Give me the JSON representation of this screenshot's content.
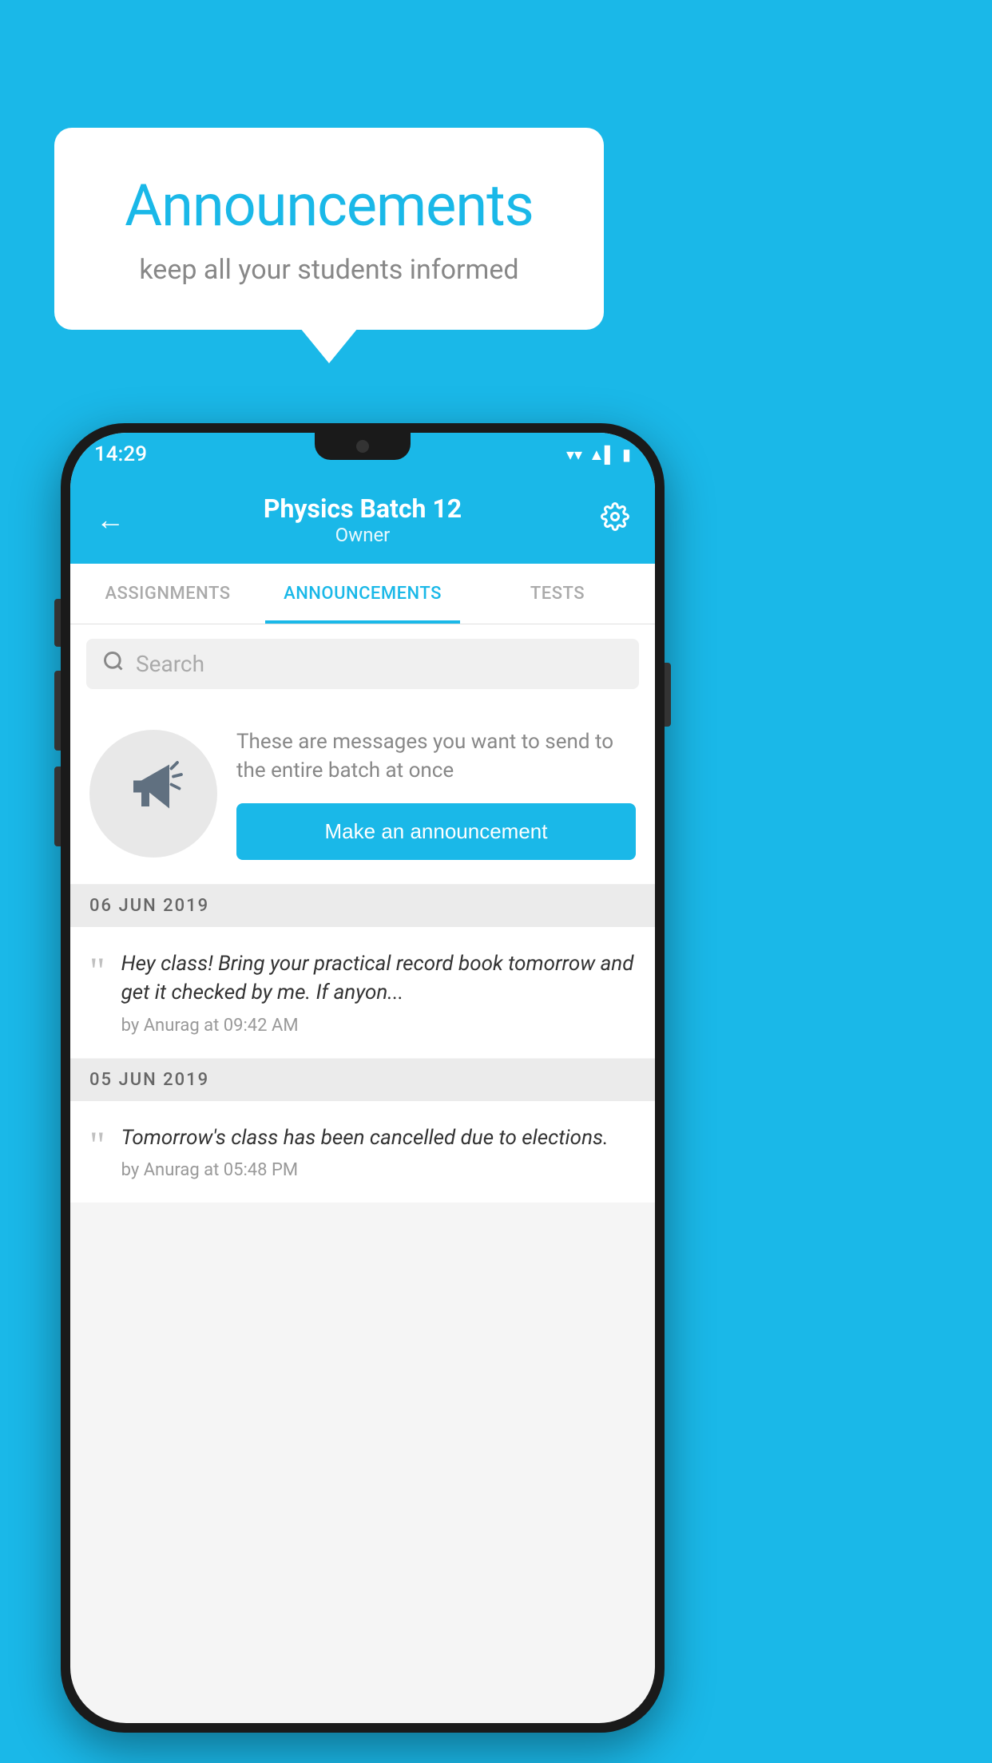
{
  "background": {
    "color": "#1ab8e8"
  },
  "speech_bubble": {
    "title": "Announcements",
    "subtitle": "keep all your students informed"
  },
  "phone": {
    "status_bar": {
      "time": "14:29",
      "wifi": "▼",
      "signal": "▲",
      "battery": "▮"
    },
    "app_bar": {
      "back_label": "←",
      "title": "Physics Batch 12",
      "subtitle": "Owner",
      "settings_label": "⚙"
    },
    "tabs": [
      {
        "label": "ASSIGNMENTS",
        "active": false
      },
      {
        "label": "ANNOUNCEMENTS",
        "active": true
      },
      {
        "label": "TESTS",
        "active": false
      }
    ],
    "search": {
      "placeholder": "Search"
    },
    "announcement_prompt": {
      "description": "These are messages you want to send to the entire batch at once",
      "button_label": "Make an announcement"
    },
    "announcements": [
      {
        "date": "06  JUN  2019",
        "message": "Hey class! Bring your practical record book tomorrow and get it checked by me. If anyon...",
        "meta": "by Anurag at 09:42 AM"
      },
      {
        "date": "05  JUN  2019",
        "message": "Tomorrow's class has been cancelled due to elections.",
        "meta": "by Anurag at 05:48 PM"
      }
    ]
  }
}
